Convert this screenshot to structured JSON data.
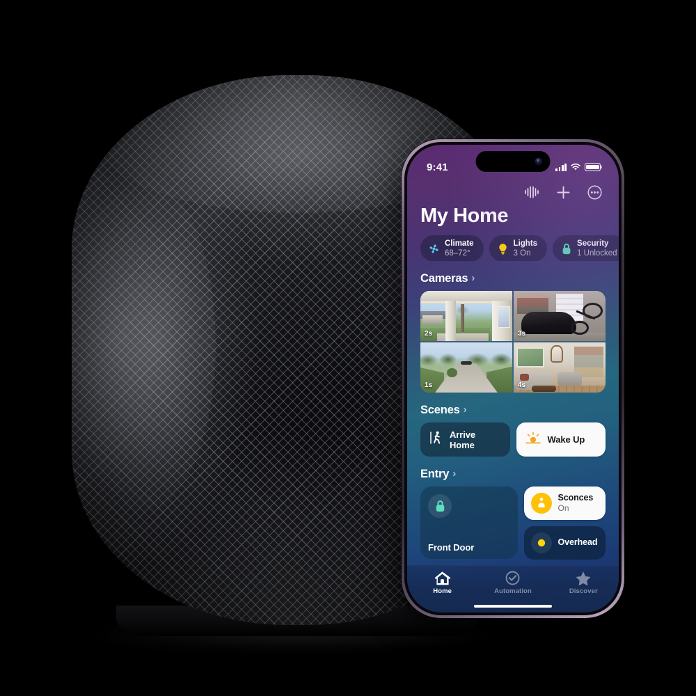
{
  "scene": {
    "device_name": "HomePod",
    "background_color": "#000000"
  },
  "phone": {
    "status_bar": {
      "time": "9:41",
      "cellular_icon": "signal-bars-icon",
      "wifi_icon": "wifi-icon",
      "battery_icon": "battery-full-icon"
    },
    "nav_actions": [
      {
        "name": "siri-waveform-icon",
        "label": "Siri"
      },
      {
        "name": "add-icon",
        "label": "Add"
      },
      {
        "name": "more-options-icon",
        "label": "More"
      }
    ],
    "title": "My Home",
    "status_chips": [
      {
        "icon": "fan-icon",
        "icon_color": "#5ac8e8",
        "title": "Climate",
        "subtitle": "68–72°"
      },
      {
        "icon": "lightbulb-icon",
        "icon_color": "#ffd60a",
        "title": "Lights",
        "subtitle": "3 On"
      },
      {
        "icon": "lock-icon",
        "icon_color": "#5ce0c0",
        "title": "Security",
        "subtitle": "1 Unlocked"
      }
    ],
    "sections": {
      "cameras": {
        "title": "Cameras",
        "chevron": "›",
        "tiles": [
          {
            "name": "camera-front-porch",
            "badge": "2s",
            "view": "front-porch"
          },
          {
            "name": "camera-garage",
            "badge": "3s",
            "view": "garage"
          },
          {
            "name": "camera-driveway",
            "badge": "1s",
            "view": "driveway"
          },
          {
            "name": "camera-living-room",
            "badge": "4s",
            "view": "living-room"
          }
        ]
      },
      "scenes": {
        "title": "Scenes",
        "chevron": "›",
        "items": [
          {
            "name": "scene-arrive-home",
            "label": "Arrive Home",
            "icon": "walking-person-icon",
            "state": "off"
          },
          {
            "name": "scene-wake-up",
            "label": "Wake Up",
            "icon": "sunrise-icon",
            "state": "on"
          }
        ]
      },
      "entry": {
        "title": "Entry",
        "chevron": "›",
        "front_door": {
          "name": "Front Door",
          "icon": "lock-icon",
          "icon_color": "#5ce0c0"
        },
        "accessories": [
          {
            "name": "Sconces",
            "status": "On",
            "icon": "sconce-lamp-icon",
            "icon_color": "#ffc107",
            "state": "on"
          },
          {
            "name": "Overhead",
            "status": "",
            "icon": "ceiling-light-icon",
            "icon_color": "#ffd60a",
            "state": "on"
          }
        ]
      }
    },
    "tabs": [
      {
        "label": "Home",
        "icon": "house-icon",
        "active": true
      },
      {
        "label": "Automation",
        "icon": "clock-check-icon",
        "active": false
      },
      {
        "label": "Discover",
        "icon": "star-icon",
        "active": false
      }
    ]
  }
}
